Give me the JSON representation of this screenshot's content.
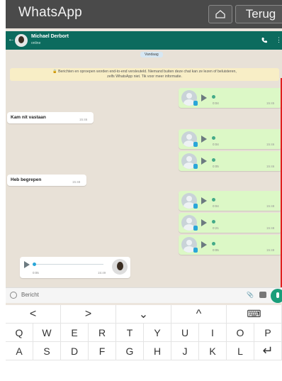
{
  "topbar": {
    "app_title": "WhatsApp",
    "home_icon": "home-icon",
    "back_label": "Terug"
  },
  "chat_header": {
    "contact_name": "Michael Derbort",
    "status": "online"
  },
  "chat": {
    "date_chip": "Vandaag",
    "encryption_notice_line1": "Berichten en oproepen worden end-to-end versleuteld. Niemand buiten deze chat kan ze lezen of beluisteren,",
    "encryption_notice_line2": "zelfs WhatsApp niet. Tik voor meer informatie.",
    "messages": [
      {
        "type": "voice",
        "dir": "out",
        "duration": "0:04",
        "time": "15:45"
      },
      {
        "type": "text",
        "dir": "in",
        "text": "Kam nit vastaan",
        "time": "15:46"
      },
      {
        "type": "voice",
        "dir": "out",
        "duration": "0:04",
        "time": "15:46"
      },
      {
        "type": "voice",
        "dir": "out",
        "duration": "0:05",
        "time": "15:46"
      },
      {
        "type": "text",
        "dir": "in",
        "text": "Heb begrepen",
        "time": "15:48"
      },
      {
        "type": "voice",
        "dir": "out",
        "duration": "0:04",
        "time": "15:48"
      },
      {
        "type": "voice",
        "dir": "out",
        "duration": "0:21",
        "time": "15:48"
      },
      {
        "type": "voice",
        "dir": "out",
        "duration": "0:05",
        "time": "15:49"
      },
      {
        "type": "voice",
        "dir": "in",
        "duration": "0:05",
        "time": "15:49"
      }
    ]
  },
  "input": {
    "placeholder": "Bericht"
  },
  "keyboard": {
    "nav_row": [
      "<",
      ">",
      "⌄",
      "^",
      "⌨"
    ],
    "row1": [
      "Q",
      "W",
      "E",
      "R",
      "T",
      "Y",
      "U",
      "I",
      "O",
      "P"
    ],
    "row2": [
      "A",
      "S",
      "D",
      "F",
      "G",
      "H",
      "J",
      "K",
      "L",
      "↵"
    ]
  },
  "colors": {
    "header_green": "#0c6b5e",
    "outgoing_bubble": "#dcf8c6",
    "highlight_red": "#e02020",
    "mic_green": "#1a9e7a"
  }
}
